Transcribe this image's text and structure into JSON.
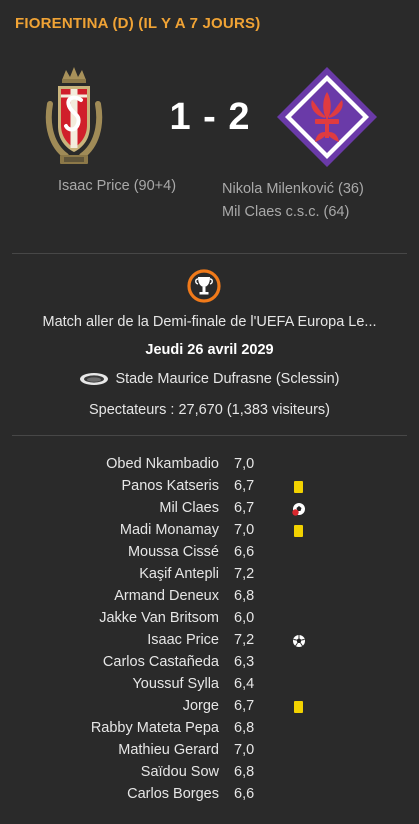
{
  "header": {
    "title": "FIORENTINA (D) (IL Y A 7 JOURS)",
    "title_color": "#f0a335"
  },
  "match": {
    "score": "1 - 2",
    "home_scorers": [
      "Isaac Price (90+4)"
    ],
    "away_scorers": [
      "Nikola Milenković (36)",
      "Mil Claes c.s.c. (64)"
    ],
    "home_crest": "standard-liege-crest",
    "away_crest": "fiorentina-crest"
  },
  "info": {
    "competition_icon": "uefa-europa-league-icon",
    "description": "Match aller de la Demi-finale de l'UEFA Europa Le...",
    "date": "Jeudi 26 avril 2029",
    "stadium_icon": "stadium-icon",
    "stadium": "Stade Maurice Dufrasne (Sclessin)",
    "attendance": "Spectateurs : 27,670 (1,383 visiteurs)"
  },
  "players": [
    {
      "name": "Obed Nkambadio",
      "rating": "7,0",
      "icon": ""
    },
    {
      "name": "Panos Katseris",
      "rating": "6,7",
      "icon": "yellow-card"
    },
    {
      "name": "Mil Claes",
      "rating": "6,7",
      "icon": "own-goal"
    },
    {
      "name": "Madi Monamay",
      "rating": "7,0",
      "icon": "yellow-card"
    },
    {
      "name": "Moussa Cissé",
      "rating": "6,6",
      "icon": ""
    },
    {
      "name": "Kaşif Antepli",
      "rating": "7,2",
      "icon": ""
    },
    {
      "name": "Armand Deneux",
      "rating": "6,8",
      "icon": ""
    },
    {
      "name": "Jakke Van Britsom",
      "rating": "6,0",
      "icon": ""
    },
    {
      "name": "Isaac Price",
      "rating": "7,2",
      "icon": "goal"
    },
    {
      "name": "Carlos Castañeda",
      "rating": "6,3",
      "icon": ""
    },
    {
      "name": "Youssuf Sylla",
      "rating": "6,4",
      "icon": ""
    },
    {
      "name": "Jorge",
      "rating": "6,7",
      "icon": "yellow-card"
    },
    {
      "name": "Rabby Mateta Pepa",
      "rating": "6,8",
      "icon": ""
    },
    {
      "name": "Mathieu Gerard",
      "rating": "7,0",
      "icon": ""
    },
    {
      "name": "Saïdou Sow",
      "rating": "6,8",
      "icon": ""
    },
    {
      "name": "Carlos Borges",
      "rating": "6,6",
      "icon": ""
    }
  ]
}
